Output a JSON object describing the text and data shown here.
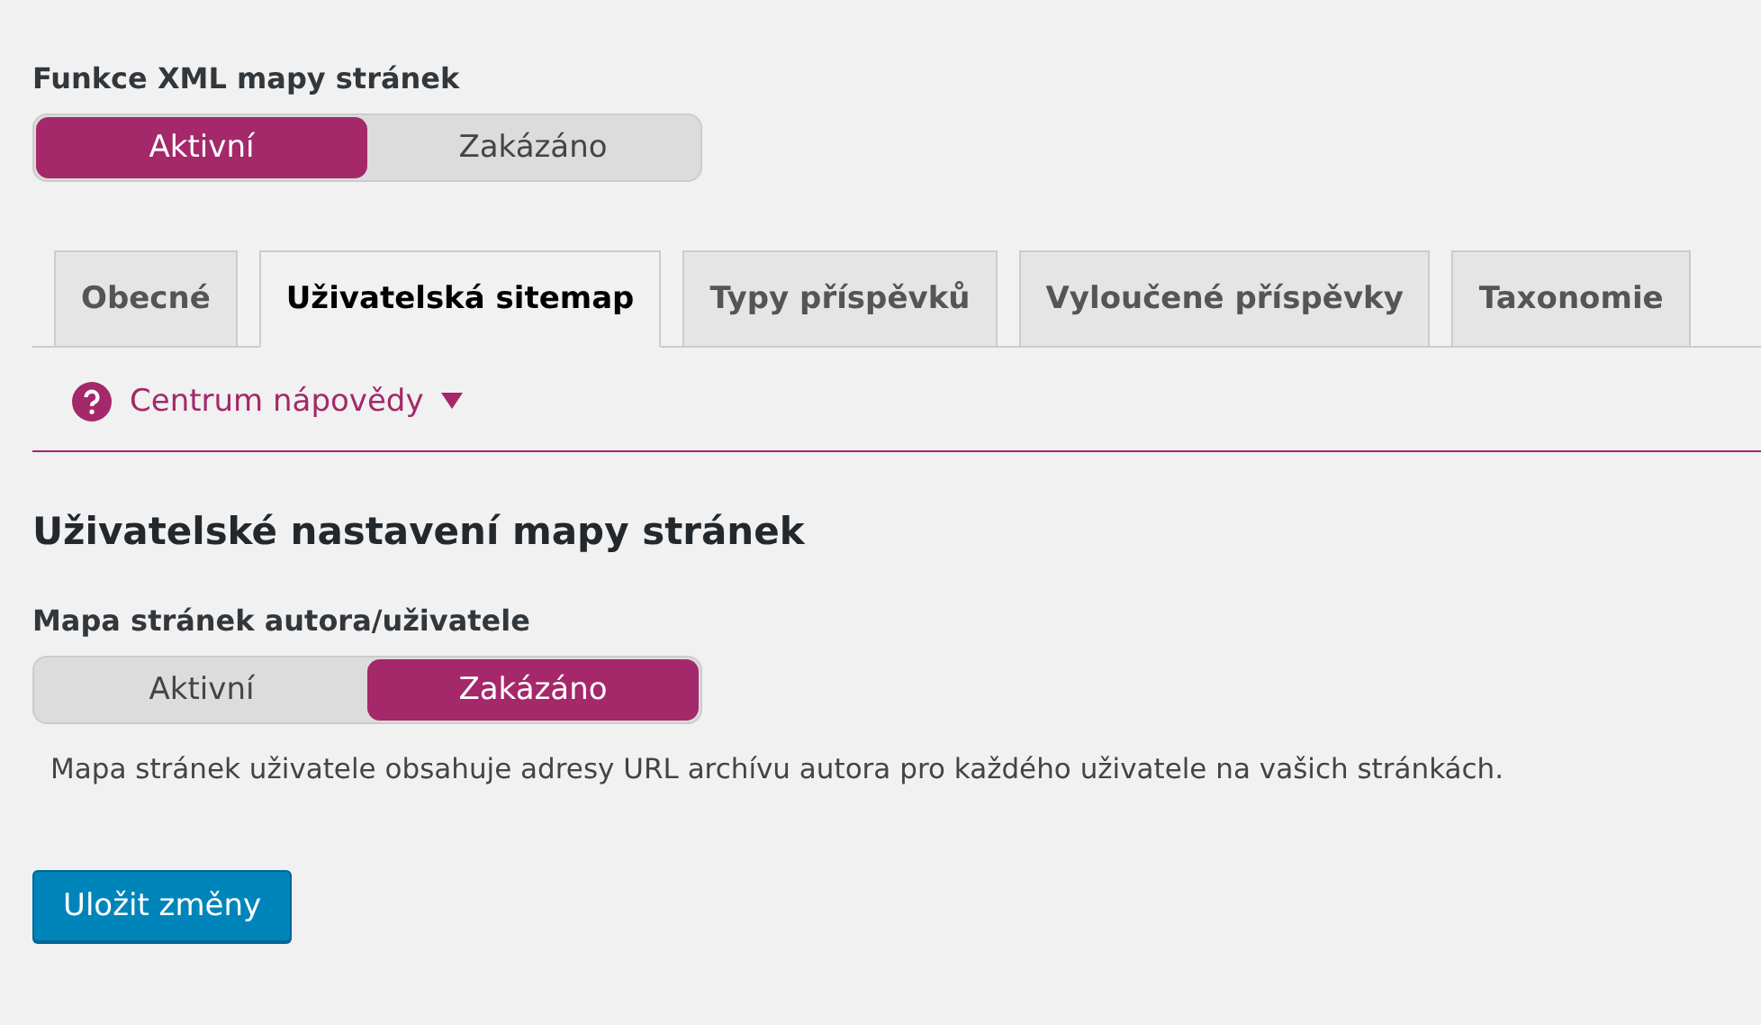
{
  "sitemap_feature": {
    "label": "Funkce XML mapy stránek",
    "options": [
      {
        "label": "Aktivní",
        "selected": true
      },
      {
        "label": "Zakázáno",
        "selected": false
      }
    ]
  },
  "tabs": [
    {
      "label": "Obecné",
      "selected": false
    },
    {
      "label": "Uživatelská sitemap",
      "selected": true
    },
    {
      "label": "Typy příspěvků",
      "selected": false
    },
    {
      "label": "Vyloučené příspěvky",
      "selected": false
    },
    {
      "label": "Taxonomie",
      "selected": false
    }
  ],
  "help_center": {
    "label": "Centrum nápovědy",
    "expanded": false
  },
  "section_title": "Uživatelské nastavení mapy stránek",
  "author_sitemap": {
    "label": "Mapa stránek autora/uživatele",
    "options": [
      {
        "label": "Aktivní",
        "selected": false
      },
      {
        "label": "Zakázáno",
        "selected": true
      }
    ],
    "description": "Mapa stránek uživatele obsahuje adresy URL archívu autora pro každého uživatele na vašich stránkách."
  },
  "save_button": "Uložit změny"
}
